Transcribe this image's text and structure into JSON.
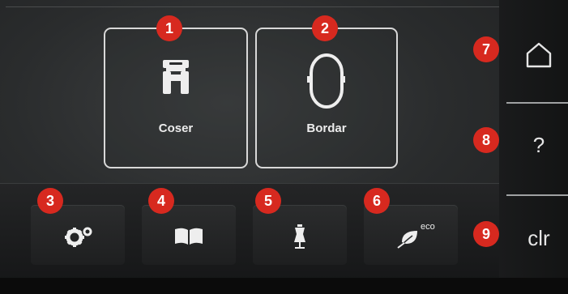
{
  "tiles": [
    {
      "label": "Coser",
      "badge": "1",
      "icon": "presser-foot-icon"
    },
    {
      "label": "Bordar",
      "badge": "2",
      "icon": "embroidery-hoop-icon"
    }
  ],
  "buttons": [
    {
      "badge": "3",
      "icon": "settings-gears-icon"
    },
    {
      "badge": "4",
      "icon": "book-icon"
    },
    {
      "badge": "5",
      "icon": "dress-form-icon"
    },
    {
      "badge": "6",
      "icon": "eco-leaf-icon",
      "text": "eco"
    }
  ],
  "side": {
    "home": {
      "badge": "7",
      "icon": "home-icon"
    },
    "help": {
      "badge": "8",
      "label": "?"
    },
    "clear": {
      "badge": "9",
      "label": "clr"
    }
  },
  "colors": {
    "badge": "#d7291f",
    "tile_border": "#d8d8d8"
  }
}
